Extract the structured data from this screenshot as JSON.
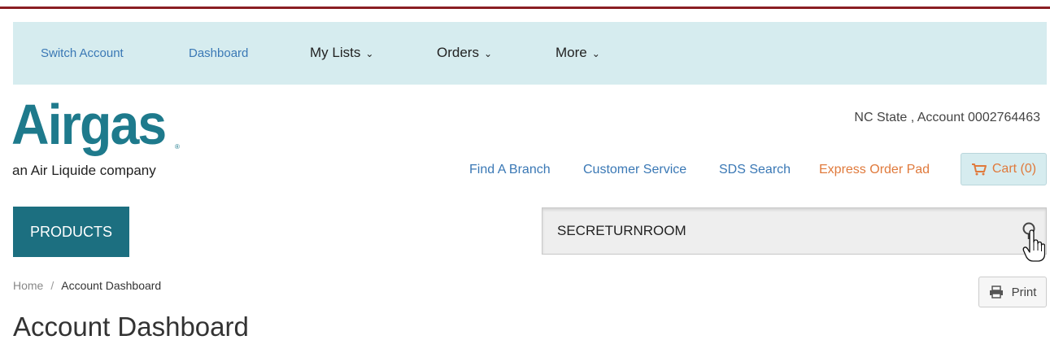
{
  "utility_nav": {
    "switch_account": "Switch Account",
    "dashboard": "Dashboard",
    "my_lists": "My Lists",
    "orders": "Orders",
    "more": "More"
  },
  "brand": {
    "logo_text": "Airgas",
    "registered_mark": "®",
    "tagline": "an Air Liquide company",
    "color": "#1e7a8c"
  },
  "account": {
    "info": "NC State , Account 0002764463"
  },
  "header_links": {
    "find_branch": "Find A Branch",
    "customer_service": "Customer Service",
    "sds_search": "SDS Search",
    "express_order_pad": "Express Order Pad"
  },
  "cart": {
    "label": "Cart (0)",
    "icon": "cart-icon"
  },
  "products_button": {
    "label": "PRODUCTS"
  },
  "search": {
    "value": "SECRETURNROOM",
    "icon": "search-icon"
  },
  "breadcrumb": {
    "home": "Home",
    "separator": "/",
    "current": "Account Dashboard"
  },
  "print_button": {
    "label": "Print",
    "icon": "printer-icon"
  },
  "page": {
    "title": "Account Dashboard"
  },
  "colors": {
    "accent_red": "#8b1e23",
    "nav_bg": "#d6ecef",
    "link_blue": "#3a78b5",
    "express_orange": "#e07a3c",
    "products_teal": "#1c6f80"
  }
}
